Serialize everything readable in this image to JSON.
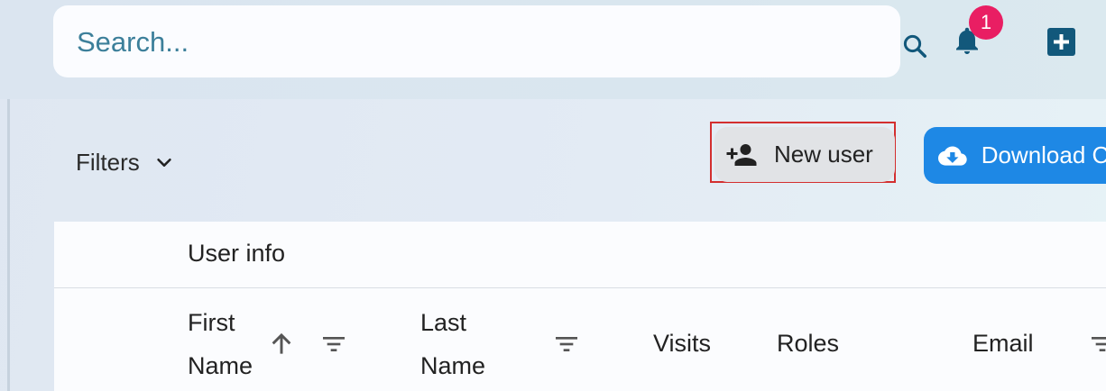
{
  "search": {
    "placeholder": "Search..."
  },
  "notifications": {
    "count": "1"
  },
  "toolbar": {
    "filters_label": "Filters",
    "new_user_label": "New user",
    "download_label": "Download CSV"
  },
  "table": {
    "group_header": "User info",
    "columns": [
      {
        "line1": "First",
        "line2": "Name"
      },
      {
        "line1": "Last",
        "line2": "Name"
      },
      {
        "label": "Visits"
      },
      {
        "label": "Roles"
      },
      {
        "label": "Email"
      }
    ]
  },
  "colors": {
    "accent": "#1e88e5",
    "badge": "#e91e63",
    "icon": "#12587b",
    "highlight": "#d32f2f"
  },
  "icons": [
    "search-icon",
    "bell-icon",
    "add-box-icon",
    "chevron-down-icon",
    "person-add-icon",
    "cloud-download-icon",
    "arrow-up-icon",
    "filter-icon"
  ]
}
